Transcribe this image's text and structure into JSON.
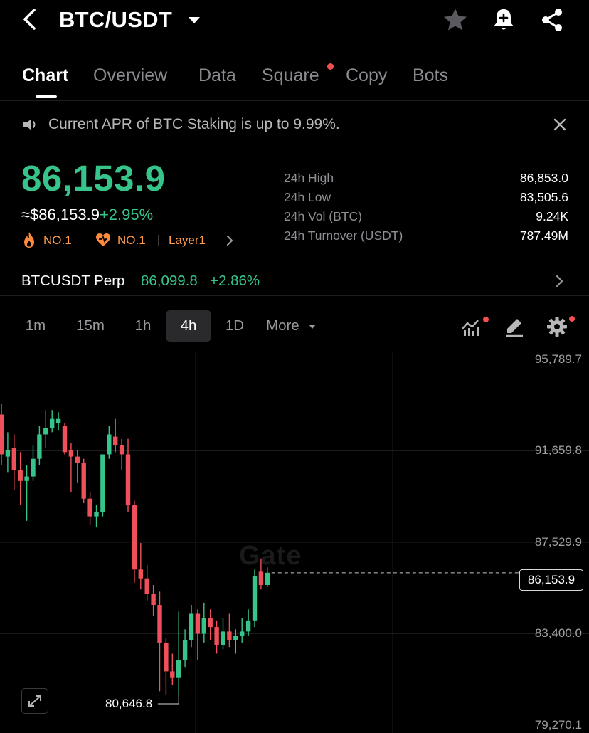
{
  "header": {
    "pair": "BTC/USDT",
    "icons": [
      "chevron-left-icon",
      "caret-down-icon",
      "star-icon",
      "bell-plus-icon",
      "share-icon"
    ]
  },
  "tabs": [
    {
      "label": "Chart",
      "active": true
    },
    {
      "label": "Overview"
    },
    {
      "label": "Data"
    },
    {
      "label": "Square",
      "has_dot": true
    },
    {
      "label": "Copy"
    },
    {
      "label": "Bots"
    }
  ],
  "notice": {
    "text": "Current APR of BTC Staking is up to 9.99%."
  },
  "ticker": {
    "last_price": "86,153.9",
    "usd_price": "≈$86,153.9",
    "change": "+2.95%",
    "badges": [
      "NO.1",
      "NO.1",
      "Layer1"
    ],
    "stats": [
      {
        "label": "24h High",
        "value": "86,853.0"
      },
      {
        "label": "24h Low",
        "value": "83,505.6"
      },
      {
        "label": "24h Vol (BTC)",
        "value": "9.24K"
      },
      {
        "label": "24h Turnover (USDT)",
        "value": "787.49M"
      }
    ]
  },
  "perp": {
    "name": "BTCUSDT Perp",
    "price": "86,099.8",
    "change": "+2.86%"
  },
  "intervals": {
    "items": [
      "1m",
      "15m",
      "1h",
      "4h",
      "1D",
      "More"
    ],
    "active": "4h"
  },
  "chart": {
    "watermark": "Gate",
    "y_ticks": [
      "95,789.7",
      "91,659.8",
      "87,529.9",
      "83,400.0",
      "79,270.1"
    ],
    "last_price_label": "86,153.9",
    "low_label": "80,646.8",
    "colors": {
      "up": "#37c48a",
      "down": "#f0505a"
    }
  },
  "chart_data": {
    "type": "candlestick",
    "interval": "4h",
    "ylim": [
      79270.1,
      95789.7
    ],
    "last": 86153.9,
    "low_marker": 80646.8,
    "candles": [
      {
        "o": 93300,
        "h": 93800,
        "c": 91500,
        "l": 91000
      },
      {
        "o": 91400,
        "h": 92500,
        "c": 91700,
        "l": 90700
      },
      {
        "o": 91800,
        "h": 92400,
        "c": 90800,
        "l": 89900
      },
      {
        "o": 90800,
        "h": 91600,
        "c": 90300,
        "l": 89200
      },
      {
        "o": 90300,
        "h": 91000,
        "c": 90500,
        "l": 88500
      },
      {
        "o": 90500,
        "h": 91900,
        "c": 91300,
        "l": 90300
      },
      {
        "o": 91300,
        "h": 92800,
        "c": 92400,
        "l": 91000
      },
      {
        "o": 92400,
        "h": 93500,
        "c": 92700,
        "l": 91800
      },
      {
        "o": 92700,
        "h": 93500,
        "c": 93100,
        "l": 92500
      },
      {
        "o": 92900,
        "h": 93400,
        "c": 93100,
        "l": 92600
      },
      {
        "o": 92800,
        "h": 92900,
        "c": 91600,
        "l": 91500
      },
      {
        "o": 91700,
        "h": 92000,
        "c": 91400,
        "l": 89800
      },
      {
        "o": 91400,
        "h": 91700,
        "c": 91100,
        "l": 90200
      },
      {
        "o": 91100,
        "h": 91300,
        "c": 89500,
        "l": 89300
      },
      {
        "o": 89500,
        "h": 89800,
        "c": 88700,
        "l": 88300
      },
      {
        "o": 88700,
        "h": 89200,
        "c": 88900,
        "l": 88200
      },
      {
        "o": 88900,
        "h": 91500,
        "c": 91500,
        "l": 88700
      },
      {
        "o": 91500,
        "h": 92800,
        "c": 92400,
        "l": 91300
      },
      {
        "o": 92300,
        "h": 93100,
        "c": 91900,
        "l": 91600
      },
      {
        "o": 91900,
        "h": 92200,
        "c": 91500,
        "l": 90800
      },
      {
        "o": 91500,
        "h": 92200,
        "c": 89200,
        "l": 88900
      },
      {
        "o": 89200,
        "h": 89400,
        "c": 86300,
        "l": 85700
      },
      {
        "o": 86300,
        "h": 87500,
        "c": 85900,
        "l": 85400
      },
      {
        "o": 85900,
        "h": 86500,
        "c": 85200,
        "l": 84900
      },
      {
        "o": 85200,
        "h": 85600,
        "c": 84700,
        "l": 84200
      },
      {
        "o": 84700,
        "h": 85300,
        "c": 83000,
        "l": 80800
      },
      {
        "o": 83000,
        "h": 83200,
        "c": 81700,
        "l": 80646.8
      },
      {
        "o": 81700,
        "h": 82500,
        "c": 81400,
        "l": 81100
      },
      {
        "o": 81400,
        "h": 84400,
        "c": 82200,
        "l": 80646.8
      },
      {
        "o": 82200,
        "h": 83600,
        "c": 83100,
        "l": 81900
      },
      {
        "o": 83100,
        "h": 84700,
        "c": 84300,
        "l": 82800
      },
      {
        "o": 84300,
        "h": 84500,
        "c": 83400,
        "l": 82200
      },
      {
        "o": 83400,
        "h": 84800,
        "c": 84100,
        "l": 83000
      },
      {
        "o": 84100,
        "h": 84500,
        "c": 83700,
        "l": 83100
      },
      {
        "o": 83700,
        "h": 84000,
        "c": 82900,
        "l": 82500
      },
      {
        "o": 82900,
        "h": 84100,
        "c": 83500,
        "l": 82700
      },
      {
        "o": 83500,
        "h": 84300,
        "c": 83100,
        "l": 82800
      },
      {
        "o": 83100,
        "h": 83600,
        "c": 83300,
        "l": 82500
      },
      {
        "o": 83300,
        "h": 84100,
        "c": 83500,
        "l": 83000
      },
      {
        "o": 83500,
        "h": 84500,
        "c": 84000,
        "l": 83300
      },
      {
        "o": 84000,
        "h": 86300,
        "c": 86000,
        "l": 83700
      },
      {
        "o": 86200,
        "h": 86800,
        "c": 85600,
        "l": 85400
      },
      {
        "o": 85600,
        "h": 86400,
        "c": 86153.9,
        "l": 85500
      }
    ]
  }
}
